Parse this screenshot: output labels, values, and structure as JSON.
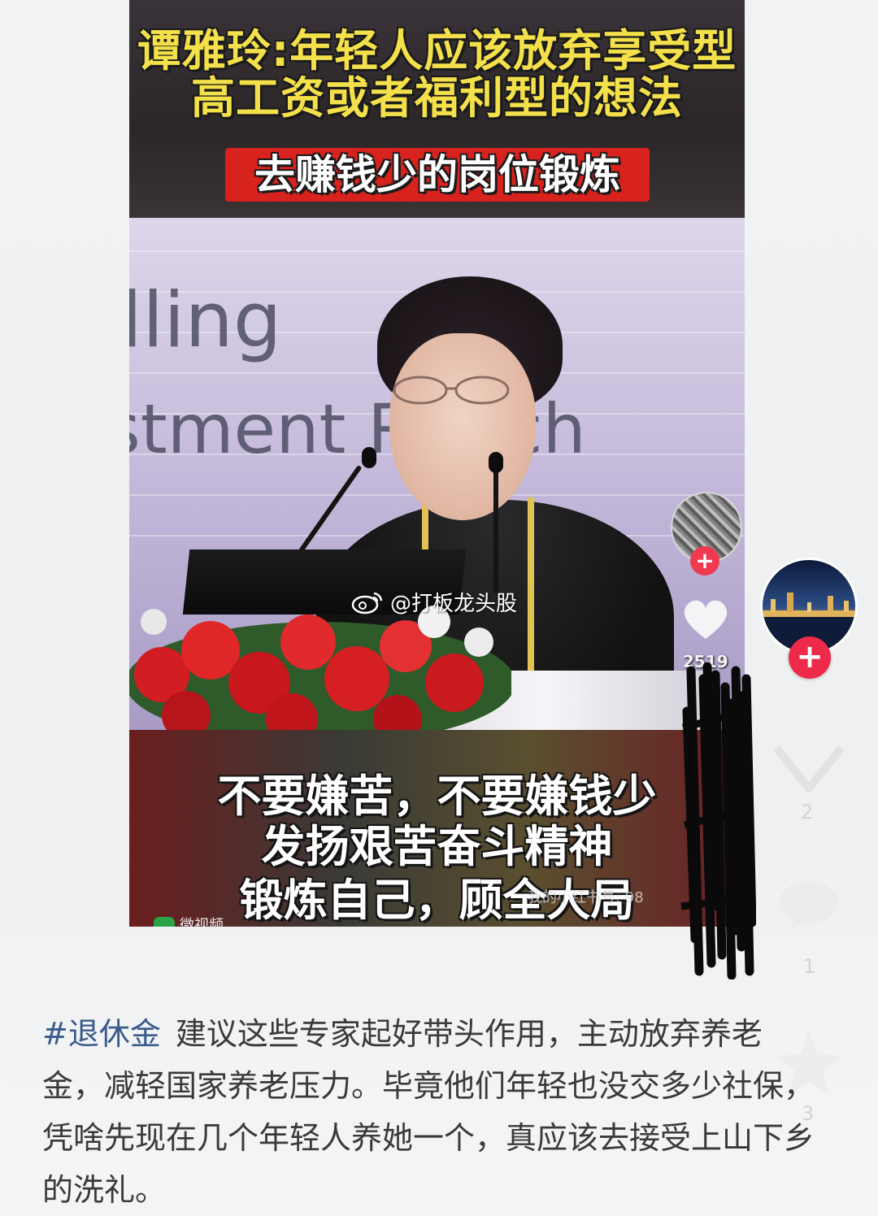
{
  "video": {
    "headline_line1": "谭雅玲:年轻人应该放弃享受型",
    "headline_line2": "高工资或者福利型的想法",
    "banner": "去赚钱少的岗位锻炼",
    "backdrop_line1": "lling",
    "backdrop_line2": "stment R   arch",
    "caption_line1": "不要嫌苦，不要嫌钱少",
    "caption_line2": "发扬艰苦奋斗精神",
    "caption_line3": "锻炼自己，顾全大局",
    "caption_watermark": "我的小红书号: 98",
    "source_label": "微视频"
  },
  "inner_controls": {
    "like_count": "2519",
    "follow_symbol": "+"
  },
  "weibo_watermark": {
    "handle": "@打板龙头股"
  },
  "outer_controls": {
    "follow_symbol": "+",
    "like_count": "2",
    "comment_count": "1",
    "star_count": "3"
  },
  "description": {
    "hashtag": "#退休金",
    "text": "建议这些专家起好带头作用，主动放弃养老金，减轻国家养老压力。毕竟他们年轻也没交多少社保，凭啥先现在几个年轻人养她一个，真应该去接受上山下乡的洗礼。"
  },
  "colors": {
    "headline_yellow": "#f3e04a",
    "banner_red": "#d8221e",
    "follow_red": "#ee2a4a",
    "hashtag_blue": "#3a5b8a"
  }
}
